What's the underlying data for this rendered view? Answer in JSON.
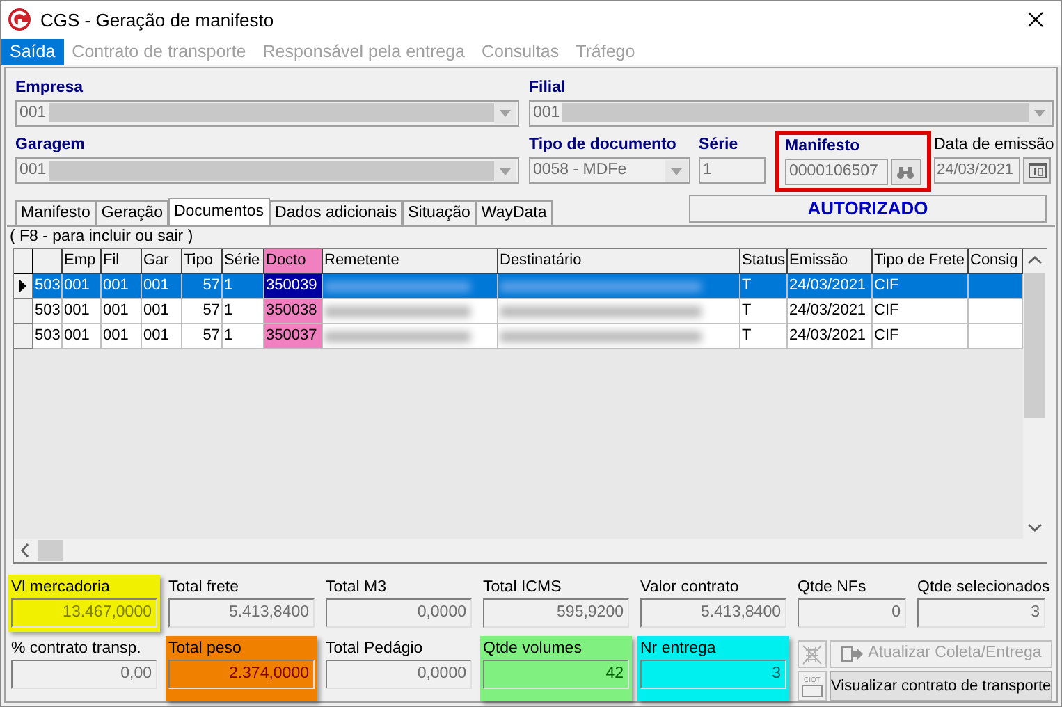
{
  "window": {
    "title": "CGS - Geração de manifesto"
  },
  "menu": [
    {
      "label": "Saída",
      "selected": true,
      "disabled": false
    },
    {
      "label": "Contrato de transporte",
      "selected": false,
      "disabled": true
    },
    {
      "label": "Responsável pela entrega",
      "selected": false,
      "disabled": true
    },
    {
      "label": "Consultas",
      "selected": false,
      "disabled": true
    },
    {
      "label": "Tráfego",
      "selected": false,
      "disabled": true
    }
  ],
  "empresa": {
    "label": "Empresa",
    "value": "001"
  },
  "filial": {
    "label": "Filial",
    "value": "001"
  },
  "garagem": {
    "label": "Garagem",
    "value": "001"
  },
  "tipo_documento": {
    "label": "Tipo de documento",
    "value": "0058 - MDFe"
  },
  "serie": {
    "label": "Série",
    "value": "1"
  },
  "manifesto": {
    "label": "Manifesto",
    "value": "0000106507"
  },
  "data_emissao": {
    "label": "Data de emissão",
    "value": "24/03/2021"
  },
  "tabs": [
    {
      "label": "Manifesto",
      "selected": false
    },
    {
      "label": "Geração",
      "selected": false
    },
    {
      "label": "Documentos",
      "selected": true
    },
    {
      "label": "Dados adicionais",
      "selected": false
    },
    {
      "label": "Situação",
      "selected": false
    },
    {
      "label": "WayData",
      "selected": false
    }
  ],
  "status": "AUTORIZADO",
  "hint": "( F8 - para incluir ou sair )",
  "table": {
    "columns": [
      {
        "highlighted": false
      },
      {
        "label": "Emp",
        "highlighted": false
      },
      {
        "label": "Fil",
        "highlighted": false
      },
      {
        "label": "Gar",
        "highlighted": false
      },
      {
        "label": "Tipo",
        "highlighted": false
      },
      {
        "label": "Série",
        "highlighted": false
      },
      {
        "label": "Docto",
        "highlighted": true
      },
      {
        "label": "Remetente",
        "highlighted": false
      },
      {
        "label": "Destinatário",
        "highlighted": false
      },
      {
        "label": "Status",
        "highlighted": false
      },
      {
        "label": "Emissão",
        "highlighted": false
      },
      {
        "label": "Tipo de Frete",
        "highlighted": false
      },
      {
        "label": "Consig",
        "highlighted": false
      }
    ],
    "rows": [
      {
        "selected": true,
        "cells": [
          "503",
          "001",
          "001",
          "001",
          "57",
          "1",
          "350039",
          "",
          "",
          "T",
          "24/03/2021",
          "CIF",
          ""
        ]
      },
      {
        "selected": false,
        "cells": [
          "503",
          "001",
          "001",
          "001",
          "57",
          "1",
          "350038",
          "",
          "",
          "T",
          "24/03/2021",
          "CIF",
          ""
        ]
      },
      {
        "selected": false,
        "cells": [
          "503",
          "001",
          "001",
          "001",
          "57",
          "1",
          "350037",
          "",
          "",
          "T",
          "24/03/2021",
          "CIF",
          ""
        ]
      }
    ]
  },
  "totals": [
    {
      "label": "Vl mercadoria",
      "value": "13.467,0000",
      "color": "#f0f000"
    },
    {
      "label": "Total frete",
      "value": "5.413,8400"
    },
    {
      "label": "Total M3",
      "value": "0,0000"
    },
    {
      "label": "Total ICMS",
      "value": "595,9200"
    },
    {
      "label": "Valor contrato",
      "value": "5.413,8400"
    },
    {
      "label": "Qtde NFs",
      "value": "0"
    },
    {
      "label": "Qtde selecionados",
      "value": "3"
    }
  ],
  "totals2": [
    {
      "label": "% contrato transp.",
      "value": "0,00"
    },
    {
      "label": "Total peso",
      "value": "2.374,0000",
      "color": "#f08000"
    },
    {
      "label": "Total Pedágio",
      "value": "0,0000"
    },
    {
      "label": "Qtde volumes",
      "value": "42",
      "color": "#80f080"
    },
    {
      "label": "Nr entrega",
      "value": "3",
      "color": "#00f0f0"
    }
  ],
  "actions": [
    {
      "label": "Atualizar Coleta/Entrega",
      "disabled": true
    },
    {
      "label": "Visualizar contrato de transporte",
      "disabled": false
    }
  ],
  "ciot_label": "CIOT"
}
